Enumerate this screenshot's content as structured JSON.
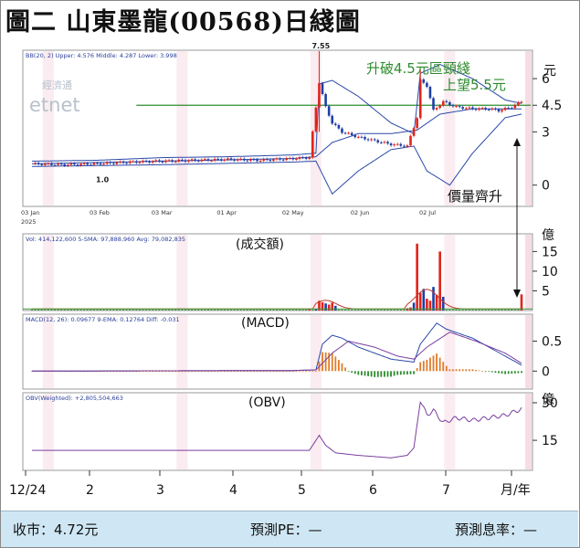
{
  "title": "圖二  山東墨龍(00568)日綫圖",
  "watermark": {
    "line1": "經濟通",
    "line2": "etnet"
  },
  "footer": {
    "close": "收市：4.72元",
    "pe": "預測PE：—",
    "yield": "預測息率：—"
  },
  "colors": {
    "up": "#e2231a",
    "down": "#1f3fa6",
    "band": "#2a49a8",
    "green": "#2e8b2e",
    "purple": "#7a3fa0"
  },
  "chart_data": [
    {
      "type": "line",
      "panel": "price",
      "legend": "BB(20, 2)   Upper: 4.576   Middle: 4.287   Lower: 3.998",
      "unit": "元",
      "yticks": [
        "6",
        "4.5",
        "3",
        "0"
      ],
      "ylim": [
        -1.2,
        7.6
      ],
      "date_labels": [
        "03 Jan\n2025",
        "03 Feb",
        "03 Mar",
        "01 Apr",
        "02 May",
        "02 Jun",
        "02 Jul"
      ],
      "annotations": {
        "high": "7.55",
        "low": "1.0",
        "breakout": "升破4.5元區頸綫\n上望5.5元",
        "volume": "價量齊升"
      },
      "resistance": 4.5,
      "series": [
        {
          "name": "Close",
          "x": [
            0,
            10,
            20,
            30,
            40,
            50,
            60,
            70,
            80,
            85,
            88,
            90,
            92,
            95,
            100,
            105,
            110,
            115,
            118,
            119,
            121,
            123,
            126,
            130,
            135,
            140,
            143,
            147,
            150
          ],
          "values": [
            1.2,
            1.15,
            1.2,
            1.3,
            1.35,
            1.4,
            1.45,
            1.4,
            1.5,
            1.55,
            5.8,
            4.4,
            3.5,
            3.0,
            2.7,
            2.5,
            2.3,
            2.2,
            3.8,
            5.9,
            5.6,
            4.2,
            4.7,
            4.4,
            4.3,
            4.3,
            4.2,
            4.4,
            4.72
          ]
        },
        {
          "name": "Upper",
          "x": [
            0,
            20,
            40,
            60,
            80,
            87,
            88,
            92,
            100,
            110,
            117,
            119,
            125,
            135,
            145,
            150
          ],
          "values": [
            1.35,
            1.4,
            1.55,
            1.6,
            1.7,
            1.8,
            5.7,
            5.9,
            5.0,
            3.5,
            2.9,
            6.3,
            6.8,
            6.0,
            4.8,
            4.6
          ]
        },
        {
          "name": "Middle",
          "x": [
            0,
            40,
            80,
            87,
            92,
            100,
            110,
            118,
            125,
            135,
            150
          ],
          "values": [
            1.2,
            1.35,
            1.5,
            1.6,
            2.4,
            2.9,
            2.9,
            3.1,
            4.0,
            4.3,
            4.29
          ]
        },
        {
          "name": "Lower",
          "x": [
            0,
            40,
            80,
            87,
            92,
            100,
            110,
            117,
            121,
            128,
            135,
            145,
            150
          ],
          "values": [
            1.05,
            1.15,
            1.3,
            1.35,
            -0.5,
            0.8,
            2.0,
            2.2,
            0.8,
            0.0,
            1.8,
            3.8,
            4.0
          ]
        }
      ]
    },
    {
      "type": "bar",
      "panel": "volume",
      "label": "(成交額)",
      "legend": "Vol: 414,122,600   5-SMA: 97,888,960   Avg: 79,082,835",
      "unit": "億",
      "yticks": [
        "15",
        "10",
        "5"
      ],
      "ylim": [
        0,
        19.5
      ],
      "x": [
        85,
        87,
        88,
        89,
        90,
        91,
        92,
        93,
        115,
        116,
        117,
        118,
        119,
        120,
        121,
        122,
        123,
        124,
        125,
        126,
        150
      ],
      "values": [
        0.3,
        0.4,
        2.5,
        2.1,
        1.8,
        1.5,
        2.0,
        1.2,
        0.6,
        0.8,
        2.0,
        17.0,
        4.5,
        5.5,
        3.0,
        2.5,
        6.0,
        4.0,
        15.0,
        3.5,
        4.1
      ]
    },
    {
      "type": "bar",
      "panel": "macd",
      "label": "(MACD)",
      "legend": "MACD(12, 26): 0.09677   9-EMA: 0.12764   Diff: -0.031",
      "yticks": [
        "0.5",
        "0"
      ],
      "ylim": [
        -0.3,
        0.95
      ],
      "series": [
        {
          "name": "MACD",
          "x": [
            0,
            80,
            87,
            89,
            92,
            95,
            100,
            110,
            117,
            119,
            124,
            127,
            135,
            145,
            150
          ],
          "values": [
            0,
            0.01,
            0.02,
            0.45,
            0.6,
            0.55,
            0.4,
            0.2,
            0.15,
            0.45,
            0.8,
            0.7,
            0.55,
            0.25,
            0.1
          ]
        },
        {
          "name": "9-EMA",
          "x": [
            0,
            80,
            87,
            92,
            97,
            105,
            112,
            117,
            121,
            128,
            136,
            145,
            150
          ],
          "values": [
            0,
            0.01,
            0.02,
            0.3,
            0.5,
            0.4,
            0.25,
            0.2,
            0.4,
            0.65,
            0.5,
            0.3,
            0.13
          ]
        }
      ]
    },
    {
      "type": "line",
      "panel": "obv",
      "label": "(OBV)",
      "legend": "OBV(Weighted): +2,805,504,663",
      "unit": "億",
      "yticks": [
        "30",
        "15"
      ],
      "ylim": [
        3,
        34
      ],
      "x_month_labels": [
        "12/24",
        "2",
        "3",
        "4",
        "5",
        "6",
        "7",
        "月/年"
      ],
      "series": [
        {
          "name": "OBV",
          "x": [
            0,
            85,
            88,
            90,
            93,
            100,
            110,
            115,
            117,
            119,
            121,
            123,
            126,
            130,
            135,
            140,
            145,
            150
          ],
          "values": [
            11,
            11,
            17,
            13,
            10,
            9,
            8,
            9,
            12,
            31,
            25,
            27,
            22,
            24,
            23,
            24,
            25,
            27.5
          ]
        }
      ]
    }
  ]
}
